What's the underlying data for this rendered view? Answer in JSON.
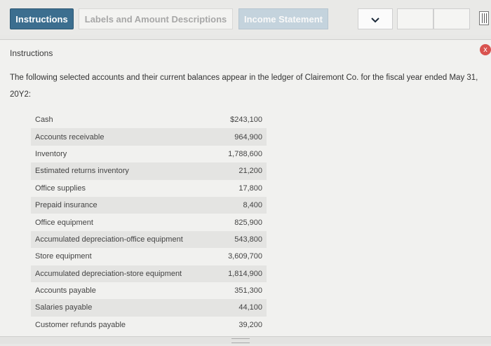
{
  "tabs": {
    "instructions": "Instructions",
    "labels": "Labels and Amount Descriptions",
    "income_statement": "Income Statement"
  },
  "dropdown_icon": "chevron-down-icon",
  "panel": {
    "title": "Instructions",
    "close_symbol": "x",
    "intro": "The following selected accounts and their current balances appear in the ledger of Clairemont Co. for the fiscal year ended May 31, 20Y2:"
  },
  "accounts": [
    {
      "name": "Cash",
      "amount": "$243,100"
    },
    {
      "name": "Accounts receivable",
      "amount": "964,900"
    },
    {
      "name": "Inventory",
      "amount": "1,788,600"
    },
    {
      "name": "Estimated returns inventory",
      "amount": "21,200"
    },
    {
      "name": "Office supplies",
      "amount": "17,800"
    },
    {
      "name": "Prepaid insurance",
      "amount": "8,400"
    },
    {
      "name": "Office equipment",
      "amount": "825,900"
    },
    {
      "name": "Accumulated depreciation-office equipment",
      "amount": "543,800"
    },
    {
      "name": "Store equipment",
      "amount": "3,609,700"
    },
    {
      "name": "Accumulated depreciation-store equipment",
      "amount": "1,814,900"
    },
    {
      "name": "Accounts payable",
      "amount": "351,300"
    },
    {
      "name": "Salaries payable",
      "amount": "44,100"
    },
    {
      "name": "Customer refunds payable",
      "amount": "39,200"
    }
  ],
  "colors": {
    "active_tab": "#3c6e8f",
    "close_button": "#d9534f"
  }
}
